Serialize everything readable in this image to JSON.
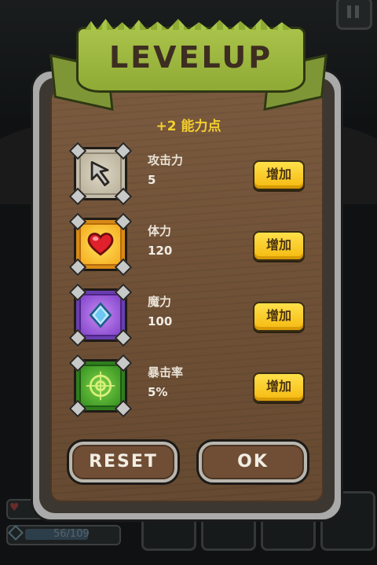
{
  "dialog": {
    "title": "LEVELUP",
    "points_text": "+2 能力点"
  },
  "stats": [
    {
      "name": "攻击力",
      "value": "5",
      "icon": "arrow-cursor-icon",
      "button": "增加"
    },
    {
      "name": "体力",
      "value": "120",
      "icon": "heart-icon",
      "button": "增加"
    },
    {
      "name": "魔力",
      "value": "100",
      "icon": "diamond-gem-icon",
      "button": "增加"
    },
    {
      "name": "暴击率",
      "value": "5%",
      "icon": "crosshair-target-icon",
      "button": "增加"
    }
  ],
  "buttons": {
    "reset": "RESET",
    "ok": "OK"
  },
  "hud": {
    "mana_text": "56/109"
  },
  "colors": {
    "banner_green": "#9bb73f",
    "points_yellow": "#f4cf2f",
    "button_gold": "#f5b90f",
    "wood_brown": "#7a5a3f"
  }
}
